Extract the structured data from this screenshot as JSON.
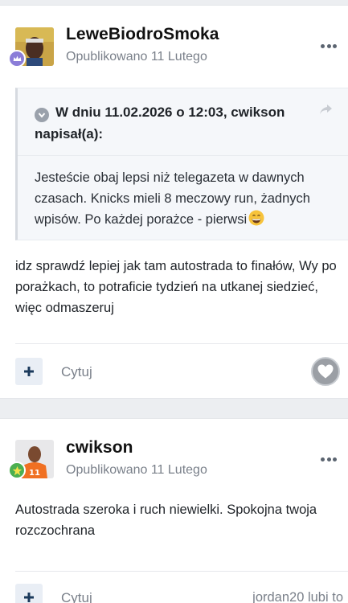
{
  "posts": [
    {
      "author": "LeweBiodroSmoka",
      "published": "Opublikowano 11 Lutego",
      "quote": {
        "header": "W dniu 11.02.2026 o 12:03, cwikson napisał(a):",
        "body": "Jesteście obaj lepsi niż telegazeta w dawnych czasach. Knicks mieli 8 meczowy run, żadnych wpisów. Po każdej porażce - pierwsi"
      },
      "body": "idz sprawdź lepiej jak tam autostrada to finałów, Wy po porażkach, to potraficie tydzień na utkanej siedzieć, więc odmaszeruj",
      "quote_button": "Cytuj",
      "plus_icon": "plus-icon",
      "heart_icon": "heart-icon",
      "rank_color": "#8b7dd8"
    },
    {
      "author": "cwikson",
      "published": "Opublikowano 11 Lutego",
      "body": "Autostrada szeroka i ruch niewielki. Spokojna twoja rozczochrana",
      "quote_button": "Cytuj",
      "reaction": "jordan20 lubi to",
      "rank_color": "#4caf50"
    }
  ],
  "colors": {
    "accent": "#1b3a5c",
    "muted": "#7a808a",
    "background": "#eceef1"
  }
}
